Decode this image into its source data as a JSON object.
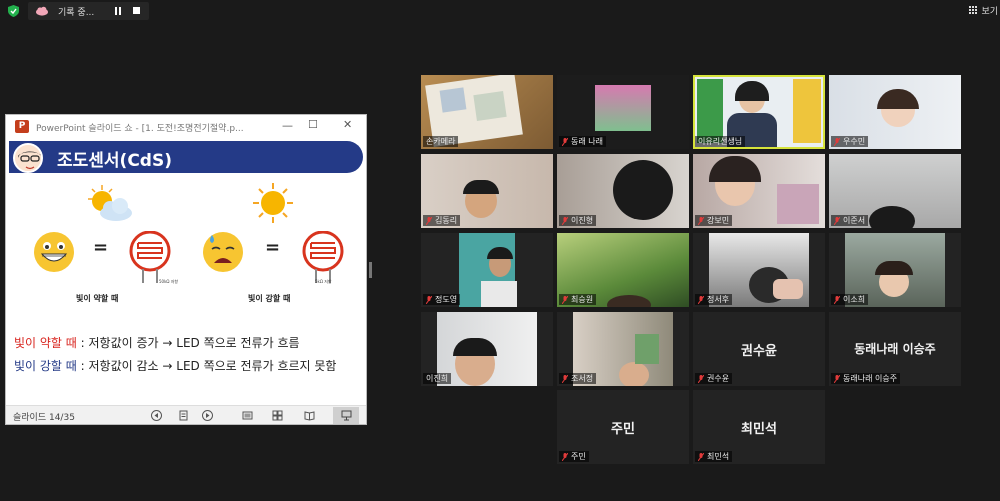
{
  "recording": {
    "label": "기록 중..."
  },
  "view": {
    "label": "보기"
  },
  "powerpoint": {
    "title": "PowerPoint 슬라이드 쇼 - [1. 도전!조명전기절약.p...",
    "status": "슬라이드 14/35",
    "slide": {
      "title": "조도센서(CdS)",
      "left_caption": "빛이 약할 때",
      "right_caption": "빛이 강할 때",
      "left_resistance": "50kΩ 저항",
      "right_resistance": "5kΩ 저항",
      "line1_highlight": "빛이 약할 때",
      "line1_rest": " : 저항값이 증가 → LED 쪽으로 전류가 흐름",
      "line2_highlight": "빛이 강할 때",
      "line2_rest": " : 저항값이 감소 → LED 쪽으로 전류가 흐르지 못함",
      "equals": "="
    }
  },
  "colors": {
    "speaker_border": "#d6e33a",
    "banner": "#243a87",
    "muted": "#e23b3b",
    "highlight_red": "#d8241e"
  },
  "participants": [
    {
      "name": "손카메라",
      "muted": false,
      "video": true
    },
    {
      "name": "동래 나래",
      "muted": true,
      "video": true
    },
    {
      "name": "이유리선생님",
      "muted": false,
      "video": true,
      "speaker": true
    },
    {
      "name": "우수민",
      "muted": true,
      "video": true
    },
    {
      "name": "김동리",
      "muted": true,
      "video": true
    },
    {
      "name": "이진형",
      "muted": true,
      "video": true
    },
    {
      "name": "강보민",
      "muted": true,
      "video": true
    },
    {
      "name": "이준서",
      "muted": true,
      "video": true
    },
    {
      "name": "정도영",
      "muted": true,
      "video": true
    },
    {
      "name": "최승원",
      "muted": true,
      "video": true
    },
    {
      "name": "정서후",
      "muted": true,
      "video": true
    },
    {
      "name": "이소희",
      "muted": true,
      "video": true
    },
    {
      "name": "이진희",
      "muted": false,
      "video": true
    },
    {
      "name": "조서정",
      "muted": true,
      "video": true
    },
    {
      "name": "권수윤",
      "muted": true,
      "video": false,
      "display": "권수윤"
    },
    {
      "name": "동래나래 이승주",
      "muted": true,
      "video": false,
      "display": "동래나래 이승주"
    },
    {
      "name": "주민",
      "muted": true,
      "video": false,
      "display": "주민"
    },
    {
      "name": "최민석",
      "muted": true,
      "video": false,
      "display": "최민석"
    }
  ]
}
